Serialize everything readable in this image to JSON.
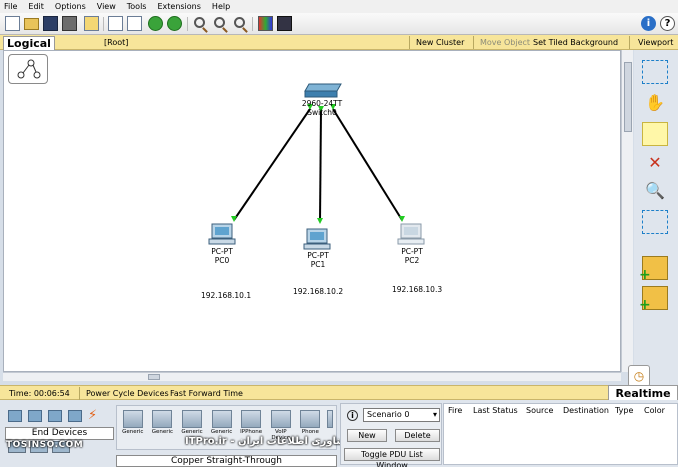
{
  "menu": [
    "File",
    "Edit",
    "Options",
    "View",
    "Tools",
    "Extensions",
    "Help"
  ],
  "toolbar": {
    "icons": [
      "new-icon",
      "open-icon",
      "save-icon",
      "print-icon",
      "activity-wizard-icon",
      "copy-icon",
      "paste-icon",
      "undo-icon",
      "redo-icon",
      "zoom-in-icon",
      "zoom-reset-icon",
      "zoom-out-icon",
      "palette-icon",
      "custom-device-icon",
      "info-icon",
      "help-icon"
    ],
    "info_glyph": "i",
    "help_glyph": "?"
  },
  "workspace_bar": {
    "tab": "Logical",
    "root": "[Root]",
    "new_cluster": "New Cluster",
    "move_object": "Move Object",
    "set_tiled_background": "Set Tiled Background",
    "viewport": "Viewport"
  },
  "topology": {
    "switch": {
      "type": "2960-24TT",
      "name": "Switch0"
    },
    "pcs": [
      {
        "type": "PC-PT",
        "name": "PC0",
        "ip": "192.168.10.1"
      },
      {
        "type": "PC-PT",
        "name": "PC1",
        "ip": "192.168.10.2"
      },
      {
        "type": "PC-PT",
        "name": "PC2",
        "ip": "192.168.10.3"
      }
    ],
    "link_color": "#000000",
    "port_color": "#22cc22"
  },
  "timebar": {
    "time": "Time: 00:06:54",
    "power_cycle": "Power Cycle Devices",
    "fast_forward": "Fast Forward Time",
    "mode": "Realtime"
  },
  "bottom": {
    "category_label": "End Devices",
    "devices": [
      "Generic",
      "Generic",
      "Generic",
      "Generic",
      "IPPhone",
      "VoIP Device",
      "Phone"
    ],
    "cable_label": "Copper Straight-Through",
    "watermark_left": "TOSINSO.COM",
    "watermark_right": "ITPro.ir - انجمن تخصصی فناوری اطلاعات ایران",
    "scenario": {
      "select": "Scenario 0",
      "new": "New",
      "delete": "Delete",
      "toggle": "Toggle PDU List Window"
    },
    "pdu_columns": [
      "Fire",
      "Last Status",
      "Source",
      "Destination",
      "Type",
      "Color"
    ]
  }
}
